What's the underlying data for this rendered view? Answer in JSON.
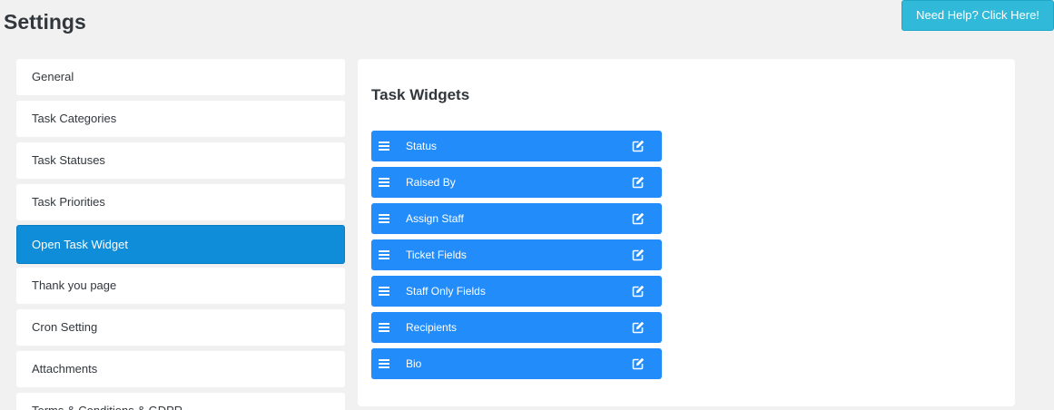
{
  "page": {
    "title": "Settings",
    "help_button": "Need Help? Click Here!"
  },
  "sidebar": {
    "items": [
      {
        "label": "General"
      },
      {
        "label": "Task Categories"
      },
      {
        "label": "Task Statuses"
      },
      {
        "label": "Task Priorities"
      },
      {
        "label": "Open Task Widget",
        "active": true
      },
      {
        "label": "Thank you page"
      },
      {
        "label": "Cron Setting"
      },
      {
        "label": "Attachments"
      },
      {
        "label": "Terms & Conditions & GDPR"
      }
    ]
  },
  "main": {
    "title": "Task Widgets",
    "widgets": [
      {
        "label": "Status",
        "drag_icon": "bars-icon",
        "edit_icon": "edit-icon"
      },
      {
        "label": "Raised By",
        "drag_icon": "bars-icon",
        "edit_icon": "edit-icon"
      },
      {
        "label": "Assign Staff",
        "drag_icon": "bars-icon",
        "edit_icon": "edit-icon"
      },
      {
        "label": "Ticket Fields",
        "drag_icon": "bars-icon",
        "edit_icon": "edit-icon"
      },
      {
        "label": "Staff Only Fields",
        "drag_icon": "bars-icon",
        "edit_icon": "edit-icon"
      },
      {
        "label": "Recipients",
        "drag_icon": "bars-icon",
        "edit_icon": "edit-icon"
      },
      {
        "label": "Bio",
        "drag_icon": "bars-icon",
        "edit_icon": "edit-icon"
      }
    ]
  },
  "colors": {
    "page_background": "#f1f1f1",
    "help_button": "#30b9d8",
    "active_menu": "#0f8dd8",
    "widget": "#228cfa"
  }
}
